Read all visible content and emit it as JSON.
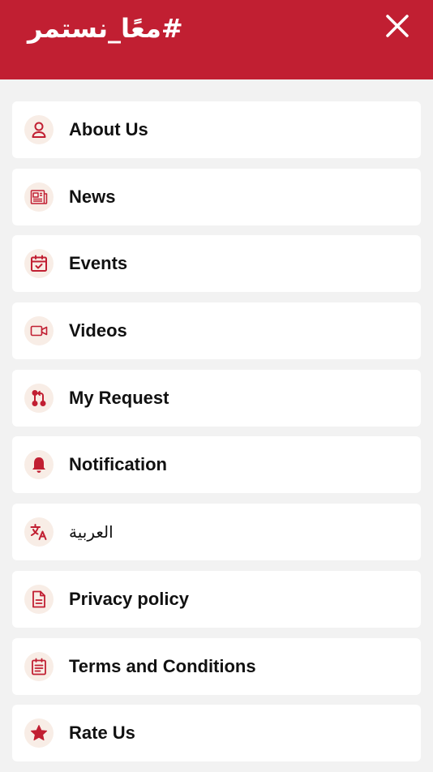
{
  "header": {
    "brand": "#معًا_نستمر"
  },
  "theme": {
    "primary": "#c11f32",
    "icon_bg": "#f8ede6",
    "page_bg": "#f2f2f2"
  },
  "menu": {
    "items": [
      {
        "label": "About Us",
        "icon": "person-icon"
      },
      {
        "label": "News",
        "icon": "newspaper-icon"
      },
      {
        "label": "Events",
        "icon": "calendar-check-icon"
      },
      {
        "label": "Videos",
        "icon": "video-camera-icon"
      },
      {
        "label": "My Request",
        "icon": "pull-request-icon"
      },
      {
        "label": "Notification",
        "icon": "bell-icon"
      },
      {
        "label": "العربية",
        "icon": "translate-icon"
      },
      {
        "label": "Privacy policy",
        "icon": "document-icon"
      },
      {
        "label": "Terms and Conditions",
        "icon": "list-calendar-icon"
      },
      {
        "label": "Rate Us",
        "icon": "star-icon"
      }
    ]
  }
}
